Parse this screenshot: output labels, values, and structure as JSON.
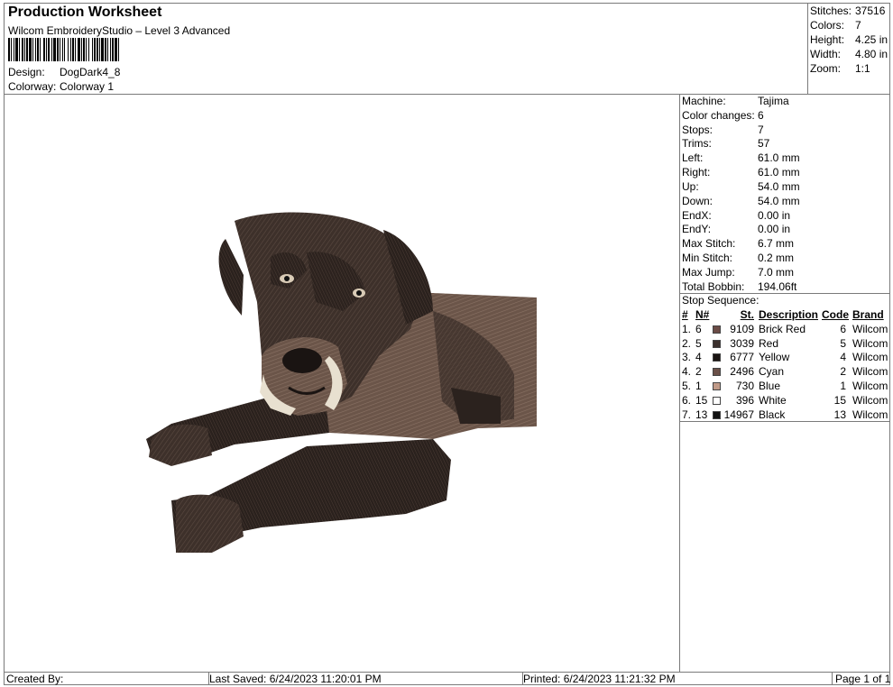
{
  "header": {
    "title": "Production Worksheet",
    "subtitle": "Wilcom EmbroideryStudio – Level 3 Advanced",
    "design_label": "Design:",
    "design_value": "DogDark4_8",
    "colorway_label": "Colorway:",
    "colorway_value": "Colorway 1"
  },
  "summary": [
    {
      "label": "Stitches:",
      "value": "37516"
    },
    {
      "label": "Colors:",
      "value": "7"
    },
    {
      "label": "Height:",
      "value": "4.25 in"
    },
    {
      "label": "Width:",
      "value": "4.80 in"
    },
    {
      "label": "Zoom:",
      "value": "1:1"
    }
  ],
  "machine_info": [
    {
      "label": "Machine:",
      "value": "Tajima"
    },
    {
      "label": "Color changes:",
      "value": "6"
    },
    {
      "label": "Stops:",
      "value": "7"
    },
    {
      "label": "Trims:",
      "value": "57"
    },
    {
      "label": "Left:",
      "value": "61.0 mm"
    },
    {
      "label": "Right:",
      "value": "61.0 mm"
    },
    {
      "label": "Up:",
      "value": "54.0 mm"
    },
    {
      "label": "Down:",
      "value": "54.0 mm"
    },
    {
      "label": "EndX:",
      "value": "0.00 in"
    },
    {
      "label": "EndY:",
      "value": "0.00 in"
    },
    {
      "label": "Max Stitch:",
      "value": "6.7 mm"
    },
    {
      "label": "Min Stitch:",
      "value": "0.2 mm"
    },
    {
      "label": "Max Jump:",
      "value": "7.0 mm"
    },
    {
      "label": "Total Bobbin:",
      "value": "194.06ft"
    }
  ],
  "stop_sequence": {
    "title": "Stop Sequence:",
    "headers": {
      "num": "#",
      "n": "N#",
      "st": "St.",
      "description": "Description",
      "code": "Code",
      "brand": "Brand"
    },
    "rows": [
      {
        "num": "1.",
        "n": "6",
        "st": "9109",
        "description": "Brick Red",
        "code": "6",
        "brand": "Wilcom",
        "color": "#6b4c46"
      },
      {
        "num": "2.",
        "n": "5",
        "st": "3039",
        "description": "Red",
        "code": "5",
        "brand": "Wilcom",
        "color": "#3b302d"
      },
      {
        "num": "3.",
        "n": "4",
        "st": "6777",
        "description": "Yellow",
        "code": "4",
        "brand": "Wilcom",
        "color": "#1a1412"
      },
      {
        "num": "4.",
        "n": "2",
        "st": "2496",
        "description": "Cyan",
        "code": "2",
        "brand": "Wilcom",
        "color": "#6a5048"
      },
      {
        "num": "5.",
        "n": "1",
        "st": "730",
        "description": "Blue",
        "code": "1",
        "brand": "Wilcom",
        "color": "#c09a88"
      },
      {
        "num": "6.",
        "n": "15",
        "st": "396",
        "description": "White",
        "code": "15",
        "brand": "Wilcom",
        "color": "#ffffff"
      },
      {
        "num": "7.",
        "n": "13",
        "st": "14967",
        "description": "Black",
        "code": "13",
        "brand": "Wilcom",
        "color": "#111111"
      }
    ]
  },
  "footer": {
    "created_by": "Created By:",
    "last_saved": "Last Saved: 6/24/2023 11:20:01 PM",
    "printed": "Printed: 6/24/2023 11:21:32 PM",
    "page": "Page 1 of 1"
  },
  "design_image": {
    "icon": "dog-embroidery-icon",
    "palette": [
      "#2c221e",
      "#4a3a33",
      "#6b5549",
      "#8a7264",
      "#d9cbb6"
    ]
  }
}
